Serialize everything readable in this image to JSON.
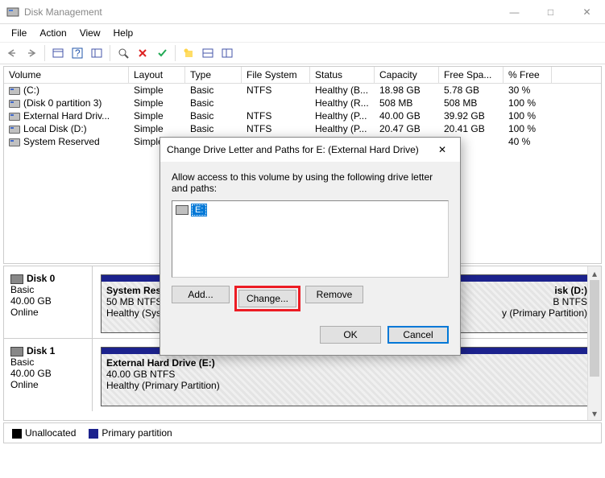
{
  "window": {
    "title": "Disk Management"
  },
  "menu": {
    "file": "File",
    "action": "Action",
    "view": "View",
    "help": "Help"
  },
  "headers": {
    "volume": "Volume",
    "layout": "Layout",
    "type": "Type",
    "fs": "File System",
    "status": "Status",
    "capacity": "Capacity",
    "free": "Free Spa...",
    "pct": "% Free"
  },
  "volumes": [
    {
      "name": "(C:)",
      "layout": "Simple",
      "type": "Basic",
      "fs": "NTFS",
      "status": "Healthy (B...",
      "cap": "18.98 GB",
      "free": "5.78 GB",
      "pct": "30 %"
    },
    {
      "name": "(Disk 0 partition 3)",
      "layout": "Simple",
      "type": "Basic",
      "fs": "",
      "status": "Healthy (R...",
      "cap": "508 MB",
      "free": "508 MB",
      "pct": "100 %"
    },
    {
      "name": "External Hard Driv...",
      "layout": "Simple",
      "type": "Basic",
      "fs": "NTFS",
      "status": "Healthy (P...",
      "cap": "40.00 GB",
      "free": "39.92 GB",
      "pct": "100 %"
    },
    {
      "name": "Local Disk (D:)",
      "layout": "Simple",
      "type": "Basic",
      "fs": "NTFS",
      "status": "Healthy (P...",
      "cap": "20.47 GB",
      "free": "20.41 GB",
      "pct": "100 %"
    },
    {
      "name": "System Reserved",
      "layout": "Simple",
      "type": "Basic",
      "fs": "",
      "status": "",
      "cap": "",
      "free": "B",
      "pct": "40 %"
    }
  ],
  "disk0": {
    "title": "Disk 0",
    "type": "Basic",
    "size": "40.00 GB",
    "status": "Online",
    "p1": {
      "name": "System Res",
      "size": "50 MB NTFS",
      "health": "Healthy (Sys"
    },
    "p2": {
      "name_suffix": "isk  (D:)",
      "size_suffix": "B NTFS",
      "health_suffix": "y (Primary Partition)"
    }
  },
  "disk1": {
    "title": "Disk 1",
    "type": "Basic",
    "size": "40.00 GB",
    "status": "Online",
    "p1": {
      "name": "External Hard Drive  (E:)",
      "size": "40.00 GB NTFS",
      "health": "Healthy (Primary Partition)"
    }
  },
  "legend": {
    "unallocated": "Unallocated",
    "primary": "Primary partition"
  },
  "dialog": {
    "title": "Change Drive Letter and Paths for E: (External Hard Drive)",
    "instruction": "Allow access to this volume by using the following drive letter and paths:",
    "item_letter": "E:",
    "add": "Add...",
    "change": "Change...",
    "remove": "Remove",
    "ok": "OK",
    "cancel": "Cancel"
  }
}
